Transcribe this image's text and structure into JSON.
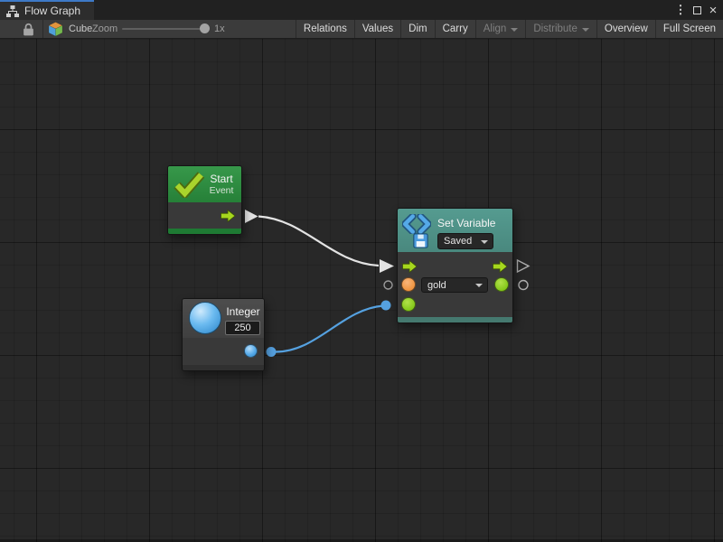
{
  "tab": {
    "title": "Flow Graph"
  },
  "window": {
    "menu_glyph": "⋮",
    "close_glyph": "×",
    "icons": [
      "kebab-menu-icon",
      "maximize-icon",
      "close-icon"
    ]
  },
  "toolbar": {
    "lock_icon": "lock-icon",
    "object_icon": "cube-icon",
    "object_name": "Cube",
    "zoom_label": "Zoom",
    "zoom_value": "1x",
    "buttons": [
      {
        "label": "Relations",
        "enabled": true,
        "has_dropdown": false
      },
      {
        "label": "Values",
        "enabled": true,
        "has_dropdown": false
      },
      {
        "label": "Dim",
        "enabled": true,
        "has_dropdown": false
      },
      {
        "label": "Carry",
        "enabled": true,
        "has_dropdown": false
      },
      {
        "label": "Align",
        "enabled": false,
        "has_dropdown": true
      },
      {
        "label": "Distribute",
        "enabled": false,
        "has_dropdown": true
      },
      {
        "label": "Overview",
        "enabled": true,
        "has_dropdown": false
      },
      {
        "label": "Full Screen",
        "enabled": true,
        "has_dropdown": false
      }
    ]
  },
  "graph": {
    "nodes": {
      "start": {
        "title": "Start",
        "subtitle": "Event",
        "icon": "checkmark-icon"
      },
      "set_variable": {
        "title": "Set Variable",
        "scope_dropdown_value": "Saved",
        "variable_dropdown_value": "gold",
        "icon": "code-chevrons-save-icon"
      },
      "integer": {
        "title": "Integer",
        "value": "250",
        "icon": "integer-sphere-icon"
      }
    },
    "connections": [
      {
        "from": "start.flow-out",
        "to": "set_variable.flow-in",
        "color": "#e3e3e3",
        "type": "flow"
      },
      {
        "from": "integer.value-out",
        "to": "set_variable.value-in",
        "color": "#55a1e0",
        "type": "value"
      }
    ]
  },
  "colors": {
    "tab_accent": "#3e79c7",
    "canvas_bg": "#282828",
    "start_header": "#2e8b41",
    "setvar_header": "#4f9186",
    "integer_header": "#474747",
    "flow_port": "#a6d71e",
    "orange_port": "#ef9440",
    "green_port": "#84c81a",
    "blue_port": "#55a9e8",
    "flow_wire": "#e3e3e3",
    "value_wire": "#55a1e0"
  }
}
